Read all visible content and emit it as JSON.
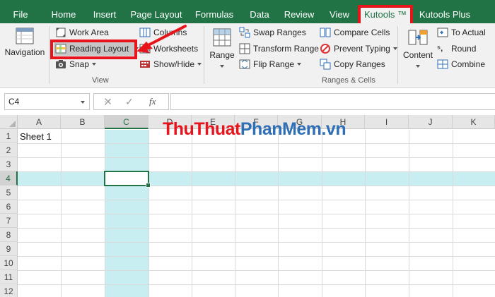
{
  "menu": {
    "tabs": [
      {
        "label": "File"
      },
      {
        "label": "Home"
      },
      {
        "label": "Insert"
      },
      {
        "label": "Page Layout"
      },
      {
        "label": "Formulas"
      },
      {
        "label": "Data"
      },
      {
        "label": "Review"
      },
      {
        "label": "View"
      },
      {
        "label": "Kutools ™"
      },
      {
        "label": "Kutools Plus"
      }
    ],
    "active_tab": "Kutools ™"
  },
  "ribbon": {
    "navigation": "Navigation",
    "view_group": {
      "work_area": "Work Area",
      "reading_layout": "Reading Layout",
      "snap": "Snap",
      "columns": "Columns",
      "worksheets": "Worksheets",
      "show_hide": "Show/Hide",
      "label": "View"
    },
    "range": "Range",
    "ranges_group": {
      "swap_ranges": "Swap Ranges",
      "transform_range": "Transform Range",
      "flip_range": "Flip Range",
      "compare_cells": "Compare Cells",
      "prevent_typing": "Prevent Typing",
      "copy_ranges": "Copy Ranges",
      "label": "Ranges & Cells"
    },
    "content": "Content",
    "content_group": {
      "to_actual": "To Actual",
      "round": "Round",
      "combine": "Combine"
    }
  },
  "formula_bar": {
    "name_box": "C4",
    "cancel": "✕",
    "enter": "✓",
    "fx": "fx",
    "value": ""
  },
  "sheet": {
    "columns": [
      "A",
      "B",
      "C",
      "D",
      "E",
      "F",
      "G",
      "H",
      "I",
      "J",
      "K"
    ],
    "rows": [
      "1",
      "2",
      "3",
      "4",
      "5",
      "6",
      "7",
      "8",
      "9",
      "10",
      "11",
      "12"
    ],
    "selected_cell": "C4",
    "cells": {
      "A1": "Sheet 1"
    }
  },
  "watermark": {
    "part1": "Thu",
    "part2": "Thuat",
    "part3": "Phan",
    "part4": "Mem",
    "part5": ".vn"
  },
  "colors": {
    "excel_green": "#217346",
    "highlight_red": "#e8141b",
    "reading_band": "#c9eef2"
  }
}
